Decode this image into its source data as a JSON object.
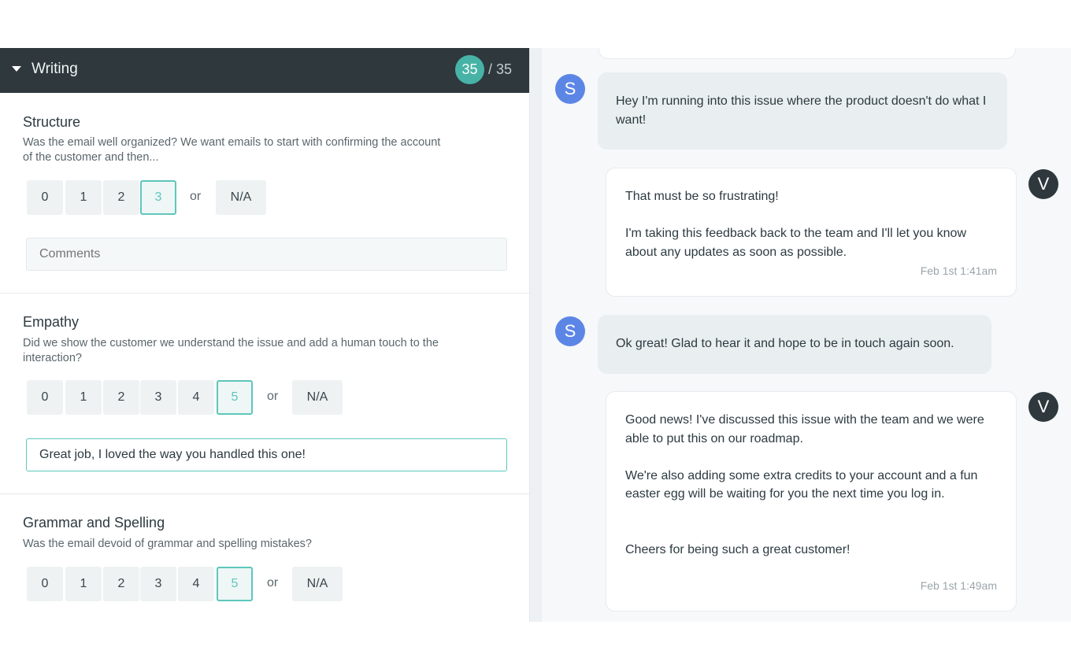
{
  "scorecard": {
    "category": "Writing",
    "score": "35",
    "total": "/ 35",
    "sections": [
      {
        "title": "Structure",
        "description": "Was the email well organized? We want emails to start with confirming the account of the customer and then...",
        "options": [
          "0",
          "1",
          "2",
          "3"
        ],
        "selected": "3",
        "or_label": "or",
        "na_label": "N/A",
        "comment_placeholder": "Comments",
        "comment_value": ""
      },
      {
        "title": "Empathy",
        "description": "Did we show the customer we understand the issue and add a human touch to the interaction?",
        "options": [
          "0",
          "1",
          "2",
          "3",
          "4",
          "5"
        ],
        "selected": "5",
        "or_label": "or",
        "na_label": "N/A",
        "comment_placeholder": "Comments",
        "comment_value": "Great job, I loved the way you handled this one!"
      },
      {
        "title": "Grammar and Spelling",
        "description": "Was the email devoid of grammar and spelling mistakes?",
        "options": [
          "0",
          "1",
          "2",
          "3",
          "4",
          "5"
        ],
        "selected": "5",
        "or_label": "or",
        "na_label": "N/A"
      }
    ]
  },
  "conversation": {
    "messages": [
      {
        "from": "customer",
        "avatar": "S",
        "text": "Hey I'm running into this issue where the product doesn't do what I want!"
      },
      {
        "from": "agent",
        "avatar": "V",
        "text": "That must be so frustrating!\n\nI'm taking this feedback back to the team and I'll let you know about any updates as soon as possible.",
        "time": "Feb 1st 1:41am"
      },
      {
        "from": "customer",
        "avatar": "S",
        "text": "Ok great! Glad to hear it and hope to be in touch again soon."
      },
      {
        "from": "agent",
        "avatar": "V",
        "text": "Good news! I've discussed this issue with the team and we were able to put this on our roadmap.\n\nWe're also adding some extra credits to your account and a fun easter egg will be waiting for you the next time you log in.\n\n\nCheers for being such a great customer!",
        "time": "Feb 1st 1:49am"
      }
    ]
  },
  "colors": {
    "header_bg": "#2e383d",
    "accent": "#5ec6bb",
    "score_badge": "#47b3a6",
    "customer_avatar": "#5c86e6",
    "agent_avatar": "#2e383d"
  }
}
